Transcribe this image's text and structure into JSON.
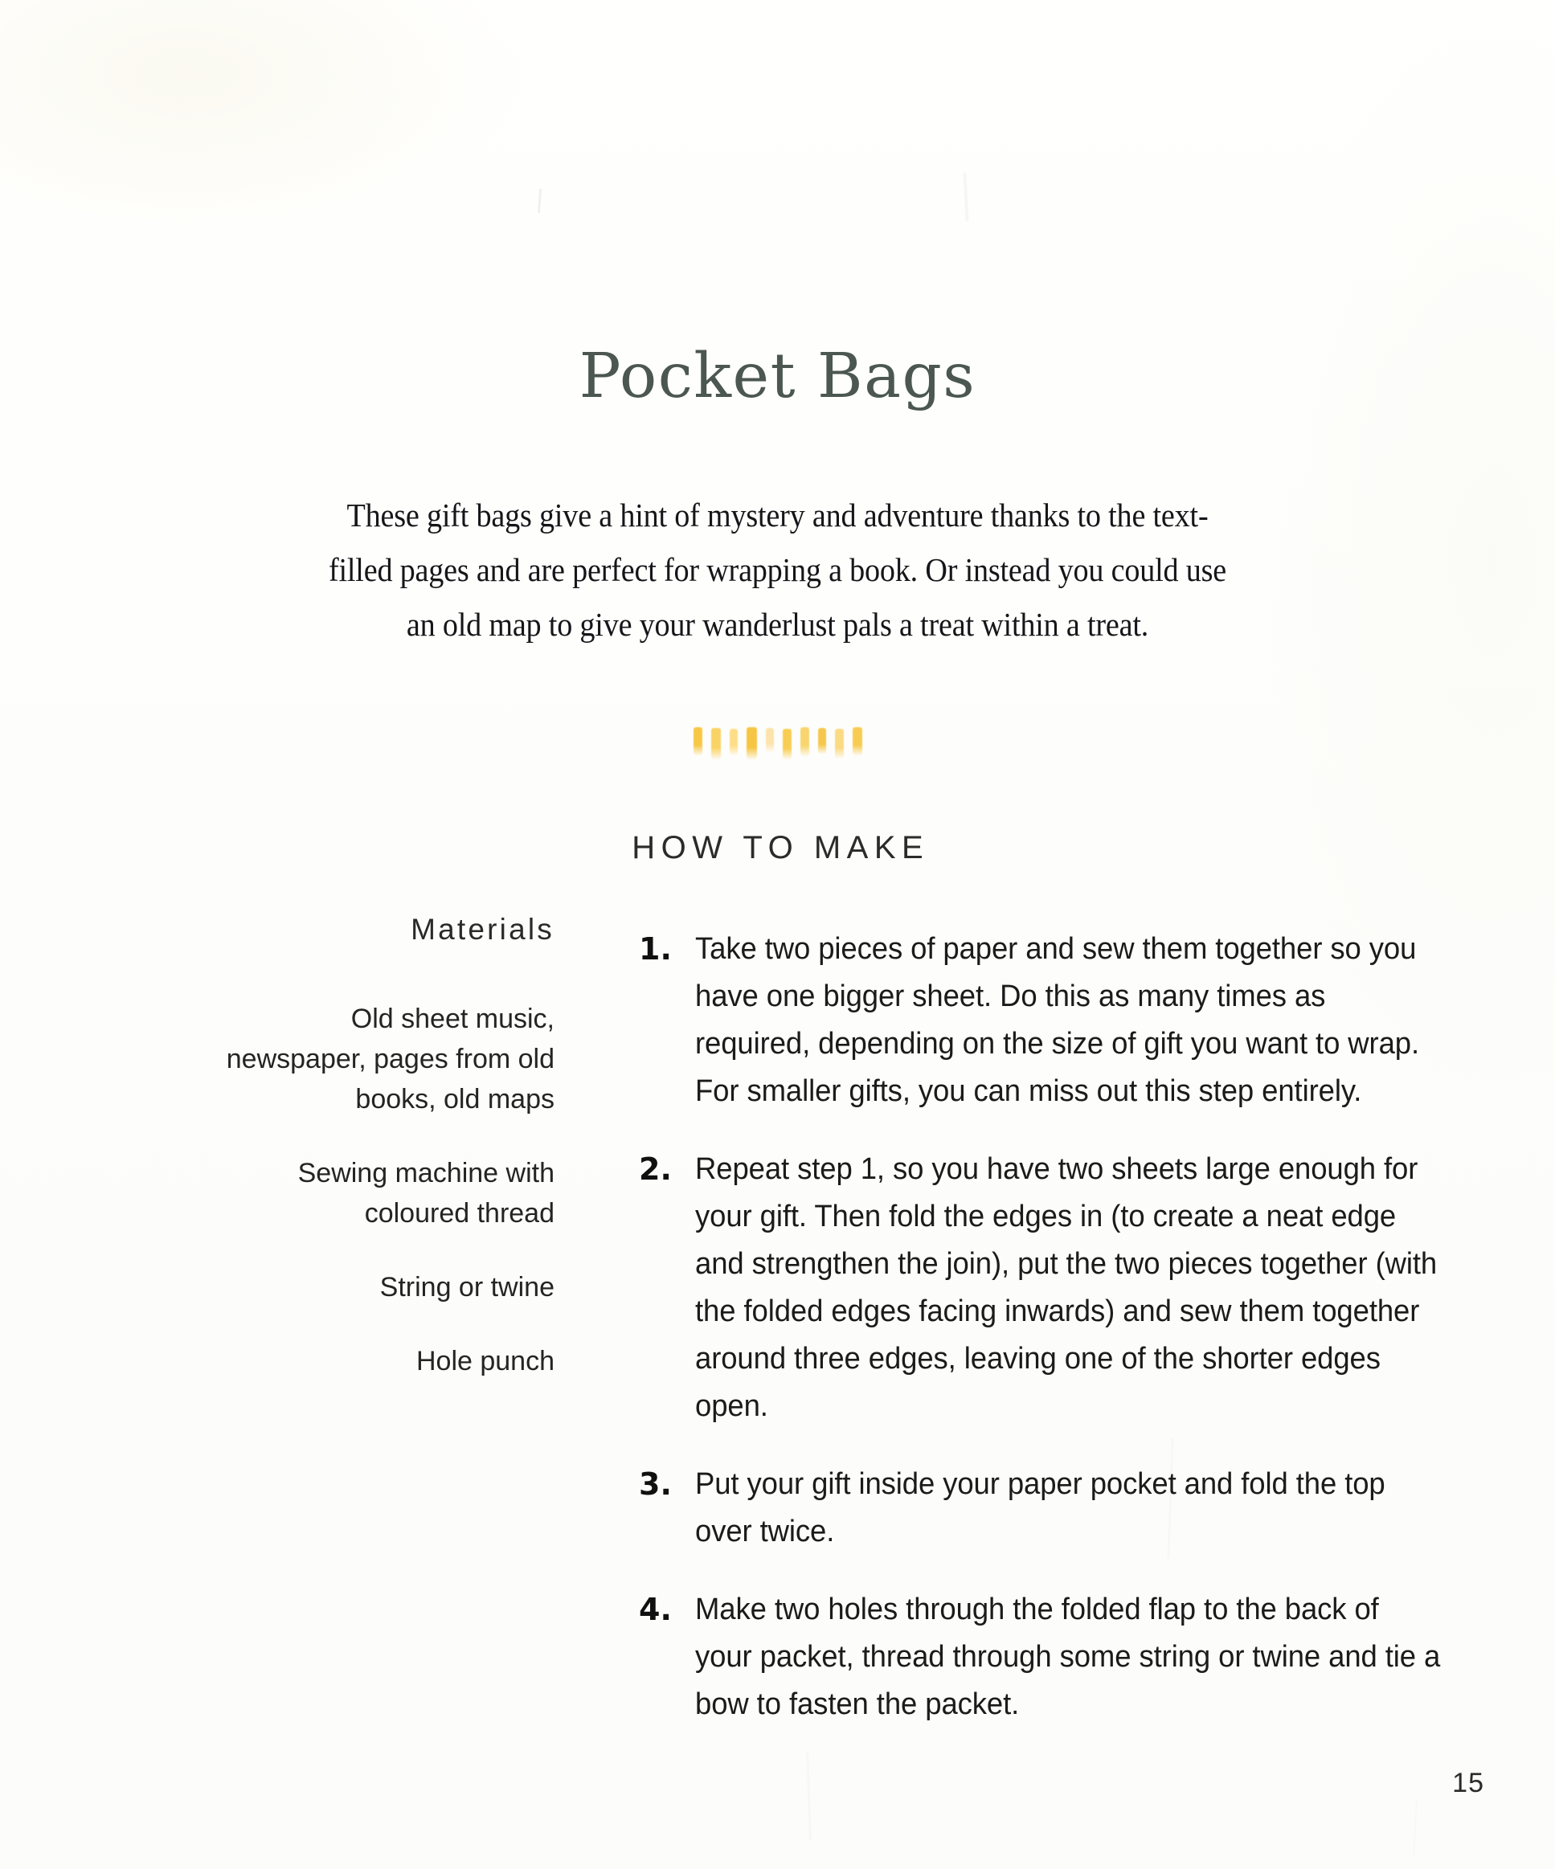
{
  "document": {
    "title": "Pocket Bags",
    "intro": "These gift bags give a hint of mystery and adventure thanks to the text-filled pages and are perfect for wrapping a book. Or instead you could use an old map to give your wanderlust pals a treat within a treat.",
    "page_number": "15"
  },
  "divider": {
    "icon": "brush-stroke-divider",
    "stroke_count": 10,
    "colors": [
      "#f7c63f",
      "#f9cf55",
      "#ffd873",
      "#f6c33a",
      "#fcd98a",
      "#f8ca46",
      "#f9d05c",
      "#f5c23a",
      "#fbd470",
      "#f8c948"
    ],
    "strokes": [
      {
        "color": "#f7c63f",
        "width": 11,
        "height": 36,
        "opacity": 0.95
      },
      {
        "color": "#f9cf55",
        "width": 12,
        "height": 40,
        "opacity": 0.9
      },
      {
        "color": "#ffd873",
        "width": 10,
        "height": 34,
        "opacity": 0.85
      },
      {
        "color": "#f6c33a",
        "width": 13,
        "height": 41,
        "opacity": 0.95
      },
      {
        "color": "#fcd98a",
        "width": 10,
        "height": 31,
        "opacity": 0.7
      },
      {
        "color": "#f8ca46",
        "width": 11,
        "height": 39,
        "opacity": 0.92
      },
      {
        "color": "#f9d05c",
        "width": 11,
        "height": 37,
        "opacity": 0.88
      },
      {
        "color": "#f5c23a",
        "width": 10,
        "height": 33,
        "opacity": 0.9
      },
      {
        "color": "#fbd470",
        "width": 11,
        "height": 38,
        "opacity": 0.85
      },
      {
        "color": "#f8c948",
        "width": 12,
        "height": 36,
        "opacity": 0.93
      }
    ]
  },
  "section": {
    "heading": "HOW TO MAKE"
  },
  "materials": {
    "heading": "Materials",
    "items": [
      "Old sheet music, newspaper, pages from old books, old maps",
      "Sewing machine with coloured thread",
      "String or twine",
      "Hole punch"
    ]
  },
  "steps": [
    {
      "number": "1.",
      "text": "Take two pieces of paper and sew them together so you have one bigger sheet. Do this as many times as required, depending on the size of gift you want to wrap. For smaller gifts, you can miss out this step entirely."
    },
    {
      "number": "2.",
      "text": "Repeat step 1, so you have two sheets large enough for your gift. Then fold the edges in (to create a neat edge and strengthen the join), put the two pieces together (with the folded edges facing inwards) and sew them together around three edges, leaving one of the shorter edges open."
    },
    {
      "number": "3.",
      "text": "Put your gift inside your paper pocket and fold the top over twice."
    },
    {
      "number": "4.",
      "text": "Make two holes through the folded flap to the back of your packet, thread through some string or twine and tie a bow to fasten the packet."
    }
  ],
  "colors": {
    "title": "#4b5750",
    "body_text": "#1b1b1b",
    "accent_yellow": "#f8c948",
    "background": "#fefefc"
  }
}
